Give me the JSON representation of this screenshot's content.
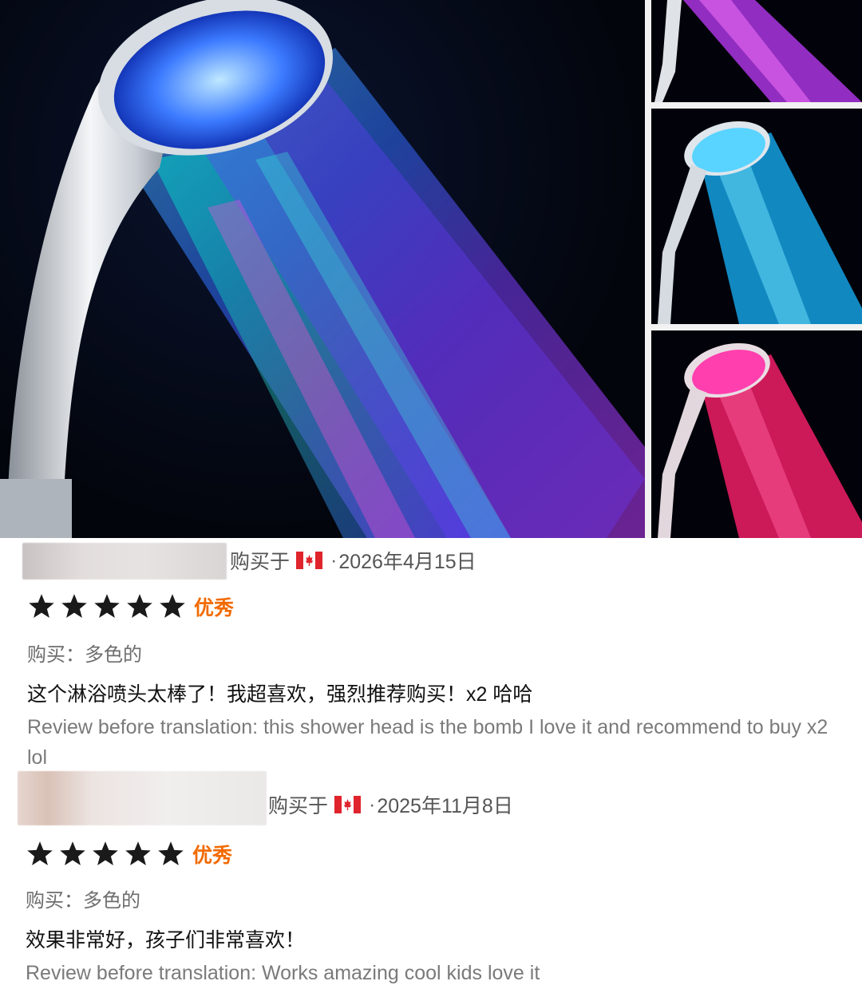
{
  "product_image": {
    "main_alt": "LED shower head main photo",
    "thumbnails": [
      "purple-spray",
      "cyan-spray",
      "pink-spray"
    ]
  },
  "colors": {
    "rating_label": "#f26a00",
    "star": "#1a1a1a",
    "meta_text": "#555555",
    "original_text": "#7a7a7a"
  },
  "reviews": [
    {
      "purchase_prefix": "购买于",
      "country_flag": "canada-flag",
      "separator": "·",
      "date": "2026年4月15日",
      "stars": 5,
      "rating_label": "优秀",
      "variant": "购买：多色的",
      "text": "这个淋浴喷头太棒了！我超喜欢，强烈推荐购买！x2 哈哈",
      "original": "Review before translation: this shower head is the bomb I love it and recommend to buy x2 lol"
    },
    {
      "purchase_prefix": "购买于",
      "country_flag": "canada-flag",
      "separator": "·",
      "date": "2025年11月8日",
      "stars": 5,
      "rating_label": "优秀",
      "variant": "购买：多色的",
      "text": "效果非常好，孩子们非常喜欢！",
      "original": "Review before translation: Works amazing cool kids love it"
    }
  ]
}
